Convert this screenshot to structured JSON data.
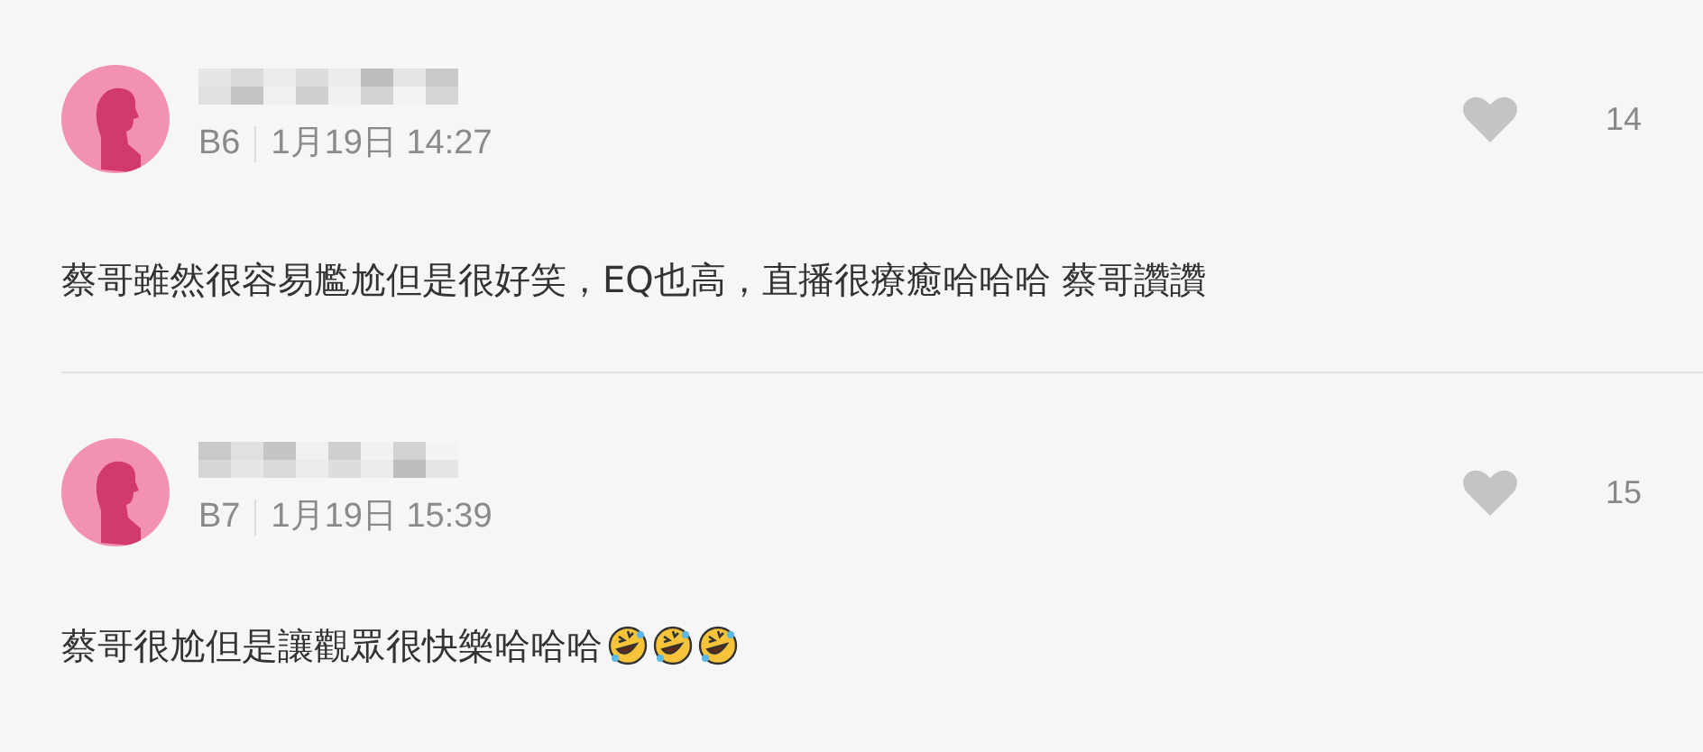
{
  "comments": [
    {
      "name_hidden": true,
      "floor": "B6",
      "time": "1月19日 14:27",
      "likes": "14",
      "liked": false,
      "text": "蔡哥雖然很容易尷尬但是很好笑，EQ也高，直播很療癒哈哈哈 蔡哥讚讚"
    },
    {
      "name_hidden": true,
      "floor": "B7",
      "time": "1月19日 15:39",
      "likes": "15",
      "liked": false,
      "text": "蔡哥很尬但是讓觀眾很快樂哈哈哈",
      "trailing_icons": [
        {
          "kind": "laughing-emoji"
        },
        {
          "kind": "laughing-emoji"
        },
        {
          "kind": "laughing-emoji"
        }
      ]
    }
  ]
}
